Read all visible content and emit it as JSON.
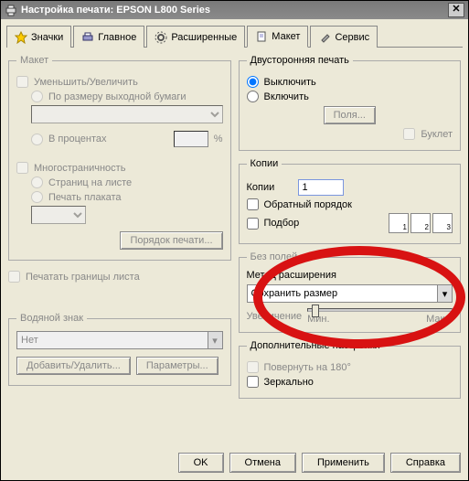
{
  "window": {
    "title": "Настройка печати: EPSON L800 Series"
  },
  "tabs": {
    "icons": "Значки",
    "main": "Главное",
    "advanced": "Расширенные",
    "layout": "Макет",
    "service": "Сервис"
  },
  "layout_group": {
    "legend": "Макет",
    "reduce_enlarge": "Уменьшить/Увеличить",
    "fit_output": "По размеру выходной бумаги",
    "percent": "В процентах",
    "percent_unit": "%",
    "multipage": "Многостраничность",
    "pages_per_sheet": "Страниц на листе",
    "poster": "Печать плаката",
    "print_order_btn": "Порядок печати...",
    "print_borders": "Печатать границы листа"
  },
  "duplex": {
    "legend": "Двусторонняя печать",
    "off": "Выключить",
    "on": "Включить",
    "margins_btn": "Поля...",
    "booklet": "Буклет"
  },
  "copies": {
    "legend": "Копии",
    "label": "Копии",
    "value": "1",
    "reverse": "Обратный порядок",
    "collate": "Подбор",
    "ic1": "1",
    "ic2": "2",
    "ic3": "3"
  },
  "borderless": {
    "legend": "Без полей",
    "method_label": "Метод расширения",
    "method_value": "Сохранить размер",
    "enlarge": "Увеличение",
    "min": "Мин.",
    "max": "Макс."
  },
  "watermark": {
    "legend": "Водяной знак",
    "value": "Нет",
    "add_del": "Добавить/Удалить...",
    "params": "Параметры..."
  },
  "additional": {
    "legend": "Дополнительные настройки",
    "rotate": "Повернуть на 180°",
    "mirror": "Зеркально"
  },
  "buttons": {
    "ok": "OK",
    "cancel": "Отмена",
    "apply": "Применить",
    "help": "Справка"
  }
}
